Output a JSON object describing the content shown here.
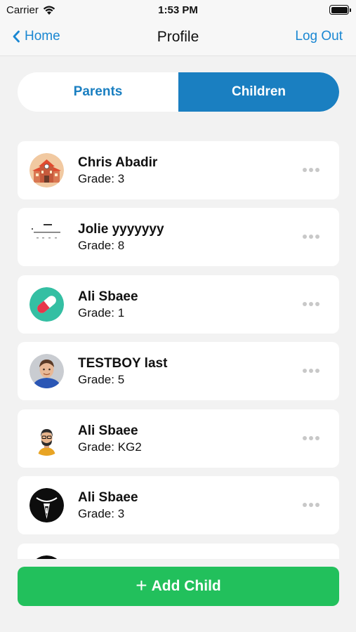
{
  "status": {
    "carrier": "Carrier",
    "time": "1:53 PM"
  },
  "nav": {
    "back_label": "Home",
    "title": "Profile",
    "logout_label": "Log Out"
  },
  "segments": [
    {
      "label": "Parents",
      "active": false
    },
    {
      "label": "Children",
      "active": true
    }
  ],
  "children": [
    {
      "name": "Chris Abadir",
      "grade": "Grade: 3",
      "avatar": "school-building-avatar"
    },
    {
      "name": "Jolie yyyyyyy",
      "grade": "Grade: 8",
      "avatar": "document-thumbnail-avatar"
    },
    {
      "name": "Ali Sbaee",
      "grade": "Grade: 1",
      "avatar": "pill-avatar"
    },
    {
      "name": "TESTBOY last",
      "grade": "Grade: 5",
      "avatar": "boy-photo-avatar"
    },
    {
      "name": "Ali Sbaee",
      "grade": "Grade: KG2",
      "avatar": "man-cartoon-avatar"
    },
    {
      "name": "Ali Sbaee",
      "grade": "Grade: 3",
      "avatar": "dark-logo-avatar"
    }
  ],
  "add_button": {
    "label": "Add Child",
    "icon": "plus-icon"
  },
  "colors": {
    "accent": "#1a7fc1",
    "link": "#1a87d2",
    "add": "#22c05c"
  }
}
